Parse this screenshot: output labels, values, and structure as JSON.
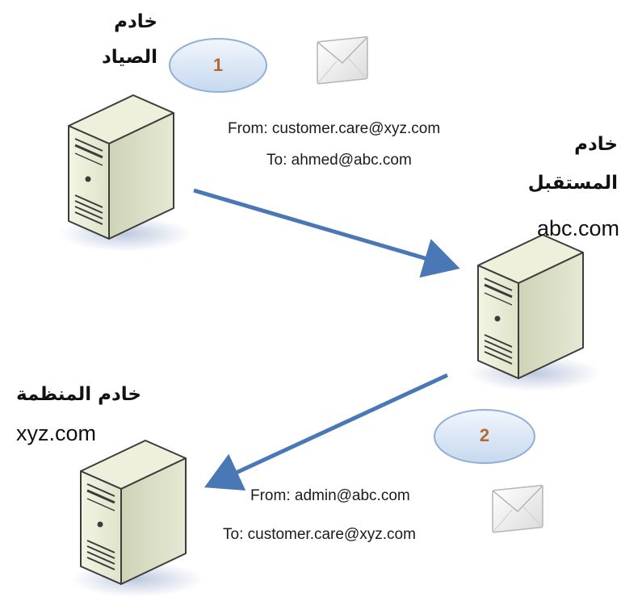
{
  "phisher_server": {
    "label_line1": "خادم",
    "label_line2": "الصياد"
  },
  "receiver_server": {
    "label_line1": "خادم",
    "label_line2": "المستقبل",
    "domain": "abc.com"
  },
  "organization_server": {
    "label": "خادم المنظمة",
    "domain": "xyz.com"
  },
  "step1": {
    "number": "1",
    "from": "From: customer.care@xyz.com",
    "to": "To:  ahmed@abc.com"
  },
  "step2": {
    "number": "2",
    "from": "From: admin@abc.com",
    "to": "To: customer.care@xyz.com"
  },
  "colors": {
    "arrow": "#4a78b6",
    "ellipse_fill": "#dbe8f6",
    "ellipse_stroke": "#8fb0d8",
    "step_number": "#b3692f",
    "server_body": "#e4e8cf",
    "server_outline": "#3c3c3c"
  },
  "icons": [
    "server-icon",
    "envelope-icon",
    "arrow"
  ]
}
